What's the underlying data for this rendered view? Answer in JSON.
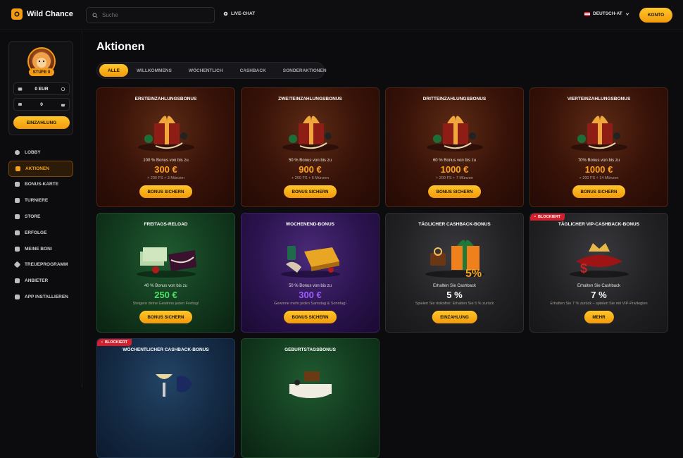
{
  "header": {
    "brand": "Wild Chance",
    "search_placeholder": "Suche",
    "livechat": "LIVE-CHAT",
    "language": "DEUTSCH-AT",
    "account_button": "KONTO"
  },
  "sidebar": {
    "level": "STUFE 0",
    "balance": "0 EUR",
    "coins": "0",
    "deposit_button": "EINZAHLUNG",
    "items": [
      {
        "label": "LOBBY",
        "icon": "chip-icon"
      },
      {
        "label": "AKTIONEN",
        "icon": "gift-icon",
        "active": true
      },
      {
        "label": "BONUS-KARTE",
        "icon": "map-icon"
      },
      {
        "label": "TURNIERE",
        "icon": "trophy-icon"
      },
      {
        "label": "STORE",
        "icon": "store-icon"
      },
      {
        "label": "ERFOLGE",
        "icon": "crown-icon"
      },
      {
        "label": "MEINE BONI",
        "icon": "bonus-icon"
      },
      {
        "label": "TREUEPROGRAMM",
        "icon": "diamond-icon"
      },
      {
        "label": "ANBIETER",
        "icon": "grid-icon"
      },
      {
        "label": "APP INSTALLIEREN",
        "icon": "download-icon"
      }
    ]
  },
  "main": {
    "title": "Aktionen",
    "tabs": [
      "ALLE",
      "WILLKOMMENS",
      "WÖCHENTLICH",
      "CASHBACK",
      "SONDERAKTIONEN"
    ],
    "cards": [
      {
        "title": "ERSTEINZAHLUNGSBONUS",
        "sub": "100 % Bonus von bis zu",
        "amount": "300 €",
        "note": "+ 200 FS + 3 Münzen",
        "button": "BONUS SICHERN",
        "theme": "red"
      },
      {
        "title": "ZWEITEINZAHLUNGSBONUS",
        "sub": "50 % Bonus von bis zu",
        "amount": "900 €",
        "note": "+ 200 FS + 6 Münzen",
        "button": "BONUS SICHERN",
        "theme": "red"
      },
      {
        "title": "DRITTEINZAHLUNGSBONUS",
        "sub": "60 % Bonus von bis zu",
        "amount": "1000 €",
        "note": "+ 200 FS + 7 Münzen",
        "button": "BONUS SICHERN",
        "theme": "red"
      },
      {
        "title": "VIERTEINZAHLUNGSBONUS",
        "sub": "70% Bonus von bis zu",
        "amount": "1000 €",
        "note": "+ 200 FS + 14 Münzen",
        "button": "BONUS SICHERN",
        "theme": "red"
      },
      {
        "title": "FREITAGS-RELOAD",
        "sub": "40 % Bonus von bis zu",
        "amount": "250 €",
        "note": "Steigere deine Gewinne jeden Freitag!",
        "button": "BONUS SICHERN",
        "theme": "green"
      },
      {
        "title": "WOCHENEND-BONUS",
        "sub": "50 % Bonus von bis zu",
        "amount": "300 €",
        "note": "Gewinne mehr jeden Samstag & Sonntag!",
        "button": "BONUS SICHERN",
        "theme": "purple"
      },
      {
        "title": "TÄGLICHER CASHBACK-BONUS",
        "sub": "Erhalten Sie Cashback",
        "amount": "5 %",
        "note": "Spielen Sie risikofrei: Erhalten Sie 5 % zurück",
        "button": "EINZAHLUNG",
        "theme": "dark"
      },
      {
        "title": "TÄGLICHER VIP-CASHBACK-BONUS",
        "sub": "Erhalten Sie Cashback",
        "amount": "7 %",
        "note": "Erhalten Sie 7 % zurück – spielen Sie mit VIP-Privilegien",
        "button": "MEHR",
        "theme": "dark",
        "blocked": "BLOCKIERT"
      },
      {
        "title": "WÖCHENTLICHER CASHBACK-BONUS",
        "theme": "blue",
        "blocked": "BLOCKIERT"
      },
      {
        "title": "GEBURTSTAGSBONUS",
        "theme": "green"
      }
    ]
  }
}
